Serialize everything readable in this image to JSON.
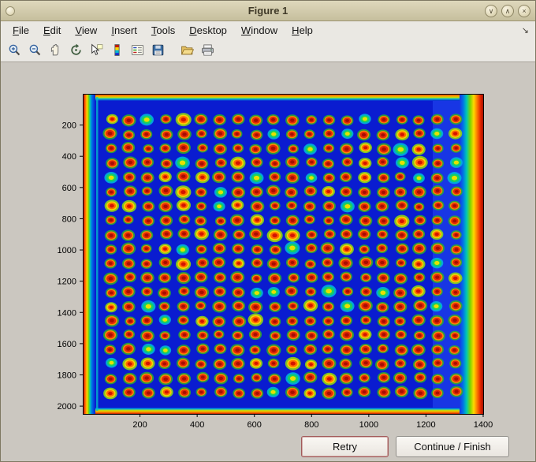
{
  "window": {
    "title": "Figure 1",
    "controls": [
      {
        "name": "shade-button",
        "icon": "chevron-down-icon",
        "glyph": "∨"
      },
      {
        "name": "maximize-button",
        "icon": "chevron-up-icon",
        "glyph": "∧"
      },
      {
        "name": "close-button",
        "icon": "close-icon",
        "glyph": "×"
      }
    ]
  },
  "menubar": {
    "items": [
      {
        "label": "File",
        "accel": 0
      },
      {
        "label": "Edit",
        "accel": 0
      },
      {
        "label": "View",
        "accel": 0
      },
      {
        "label": "Insert",
        "accel": 0
      },
      {
        "label": "Tools",
        "accel": 0
      },
      {
        "label": "Desktop",
        "accel": 0
      },
      {
        "label": "Window",
        "accel": 0
      },
      {
        "label": "Help",
        "accel": 0
      }
    ],
    "overflow_glyph": "↘"
  },
  "toolbar": {
    "icons": [
      "zoom-in",
      "zoom-out",
      "pan",
      "rotate-3d",
      "data-cursor",
      "insert-colorbar",
      "insert-legend",
      "save-figure",
      "open-file",
      "print-figure"
    ],
    "separator_after": 7
  },
  "figure": {
    "x_ticks": [
      200,
      400,
      600,
      800,
      1000,
      1200,
      1400
    ],
    "y_ticks": [
      200,
      400,
      600,
      800,
      1000,
      1200,
      1400,
      1600,
      1800,
      2000
    ],
    "x_max": 1400,
    "y_max": 2050,
    "image": {
      "description": "microplate scan, jet colormap: blue field, grid of red spots, warm red edges",
      "spot_rows": 20,
      "spot_cols": 20
    },
    "colors": {
      "field_blue": "#0a1cd0",
      "edge_red": "#a81000",
      "spot_core": "#a80e00",
      "spot_ring": "#ff8800",
      "spot_halo": "#2fae28"
    }
  },
  "buttons": {
    "retry": "Retry",
    "continue": "Continue / Finish"
  }
}
